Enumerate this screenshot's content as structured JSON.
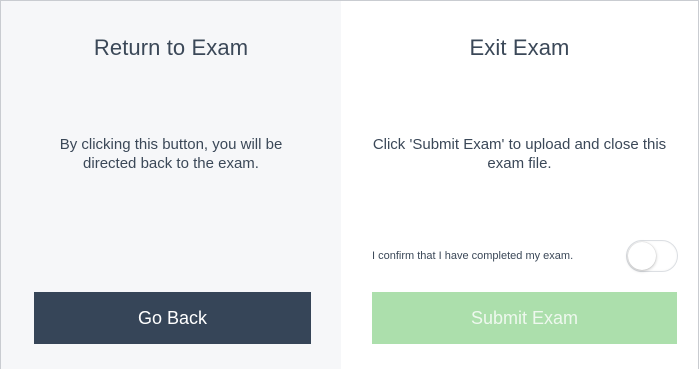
{
  "return_panel": {
    "title": "Return to Exam",
    "description": "By clicking this button, you will be directed back to the exam.",
    "button_label": "Go Back"
  },
  "exit_panel": {
    "title": "Exit Exam",
    "description": "Click 'Submit Exam' to upload and close this exam file.",
    "confirm_label": "I confirm that I have completed my exam.",
    "confirm_checked": false,
    "button_label": "Submit Exam",
    "button_enabled": false
  },
  "colors": {
    "go_back_button": "#364558",
    "submit_button_disabled": "#acdfac",
    "left_panel_bg": "#f6f7f9",
    "text": "#3b4858"
  }
}
